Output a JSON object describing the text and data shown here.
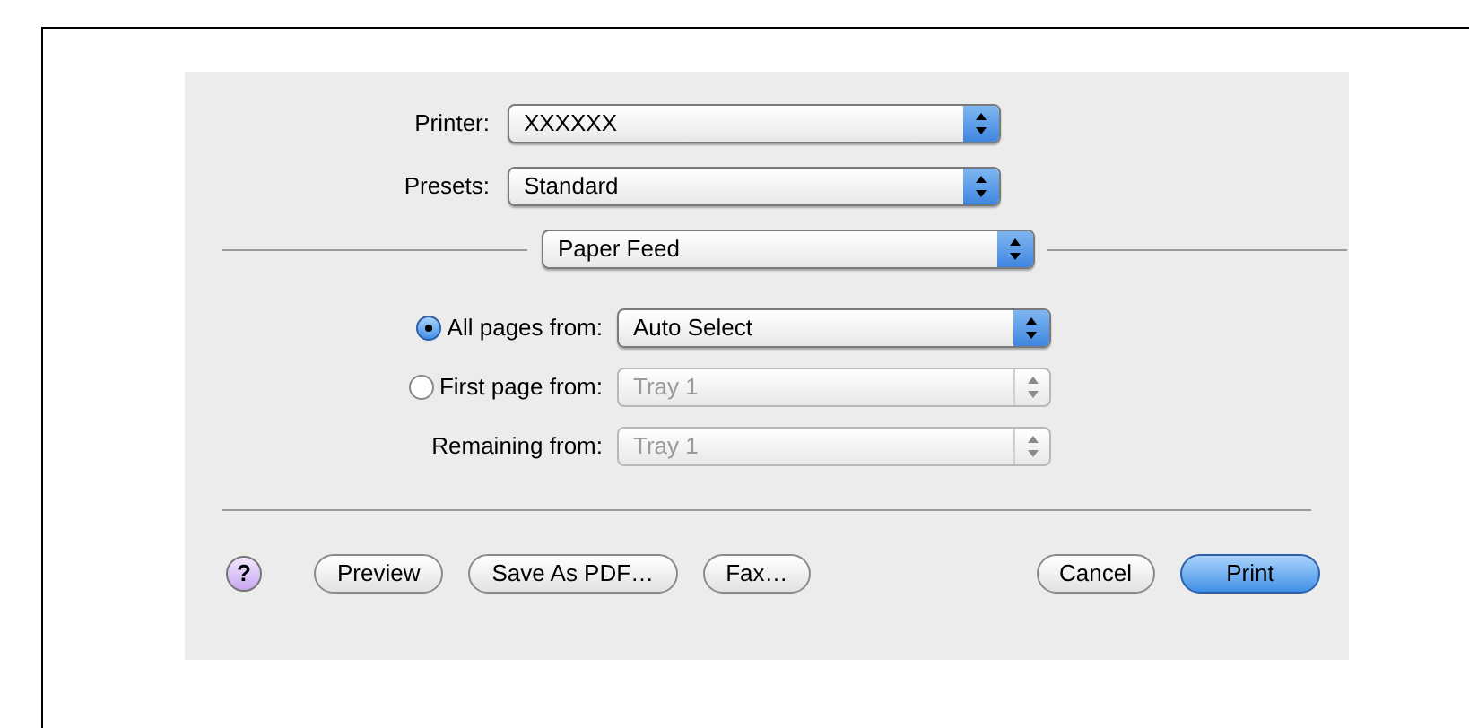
{
  "printer": {
    "label": "Printer:",
    "value": "XXXXXX"
  },
  "presets": {
    "label": "Presets:",
    "value": "Standard"
  },
  "section": {
    "value": "Paper Feed"
  },
  "sources": [
    {
      "kind": "radio",
      "label": "All pages from:",
      "value": "Auto Select",
      "selected": true,
      "disabled": false
    },
    {
      "kind": "radio",
      "label": "First page from:",
      "value": "Tray 1",
      "selected": false,
      "disabled": true
    },
    {
      "kind": "plain",
      "label": "Remaining from:",
      "value": "Tray 1",
      "disabled": true
    }
  ],
  "help": "?",
  "buttons": [
    {
      "label": "Preview",
      "default": false
    },
    {
      "label": "Save As PDF…",
      "default": false
    },
    {
      "label": "Fax…",
      "default": false
    }
  ],
  "actions": [
    {
      "label": "Cancel",
      "default": false
    },
    {
      "label": "Print",
      "default": true
    }
  ]
}
